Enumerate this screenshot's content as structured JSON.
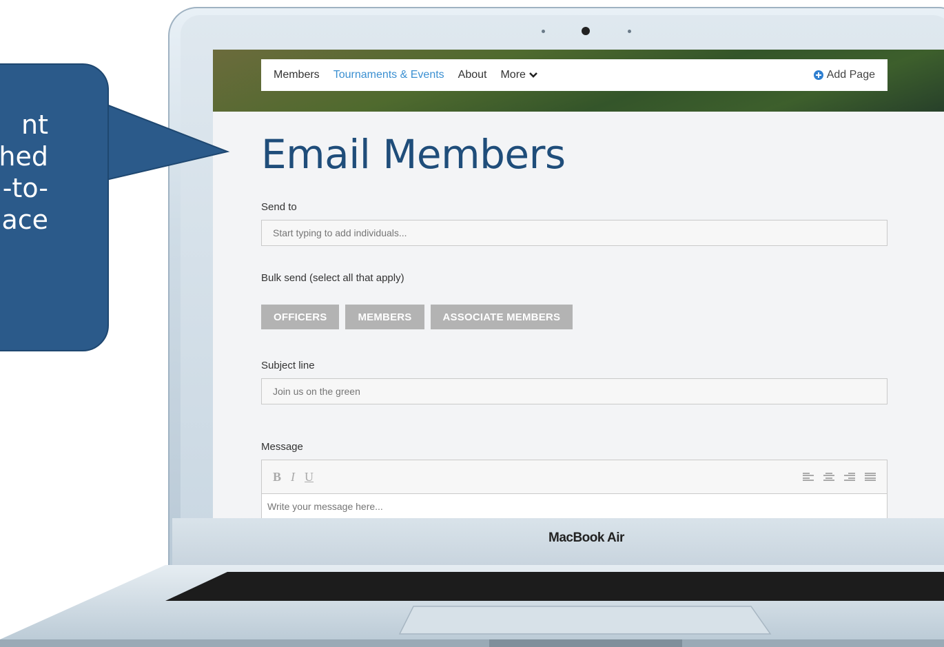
{
  "callout": {
    "lines": [
      "nt",
      "hed",
      "-to-",
      "ace"
    ]
  },
  "navbar": {
    "items": [
      {
        "label": "Members"
      },
      {
        "label": "Tournaments & Events",
        "active": true
      },
      {
        "label": "About"
      },
      {
        "label": "More"
      }
    ],
    "add_page_label": "Add Page"
  },
  "page": {
    "title": "Email Members",
    "send_to_label": "Send to",
    "send_to_placeholder": "Start typing to add individuals...",
    "bulk_label": "Bulk send (select all that apply)",
    "bulk_buttons": [
      "OFFICERS",
      "MEMBERS",
      "ASSOCIATE MEMBERS"
    ],
    "subject_label": "Subject line",
    "subject_placeholder": "Join us on the green",
    "message_label": "Message",
    "editor": {
      "bold": "B",
      "italic": "I",
      "underline": "U"
    },
    "message_placeholder": "Write your message here..."
  },
  "device": {
    "brand": "MacBook Air"
  },
  "colors": {
    "accent": "#3a8fd1",
    "title": "#1f4d7a",
    "callout": "#2b5a8a",
    "bulk_button": "#b3b3b3"
  },
  "icons": {
    "add_page": "plus-circle-icon",
    "more": "chevron-down-icon"
  }
}
